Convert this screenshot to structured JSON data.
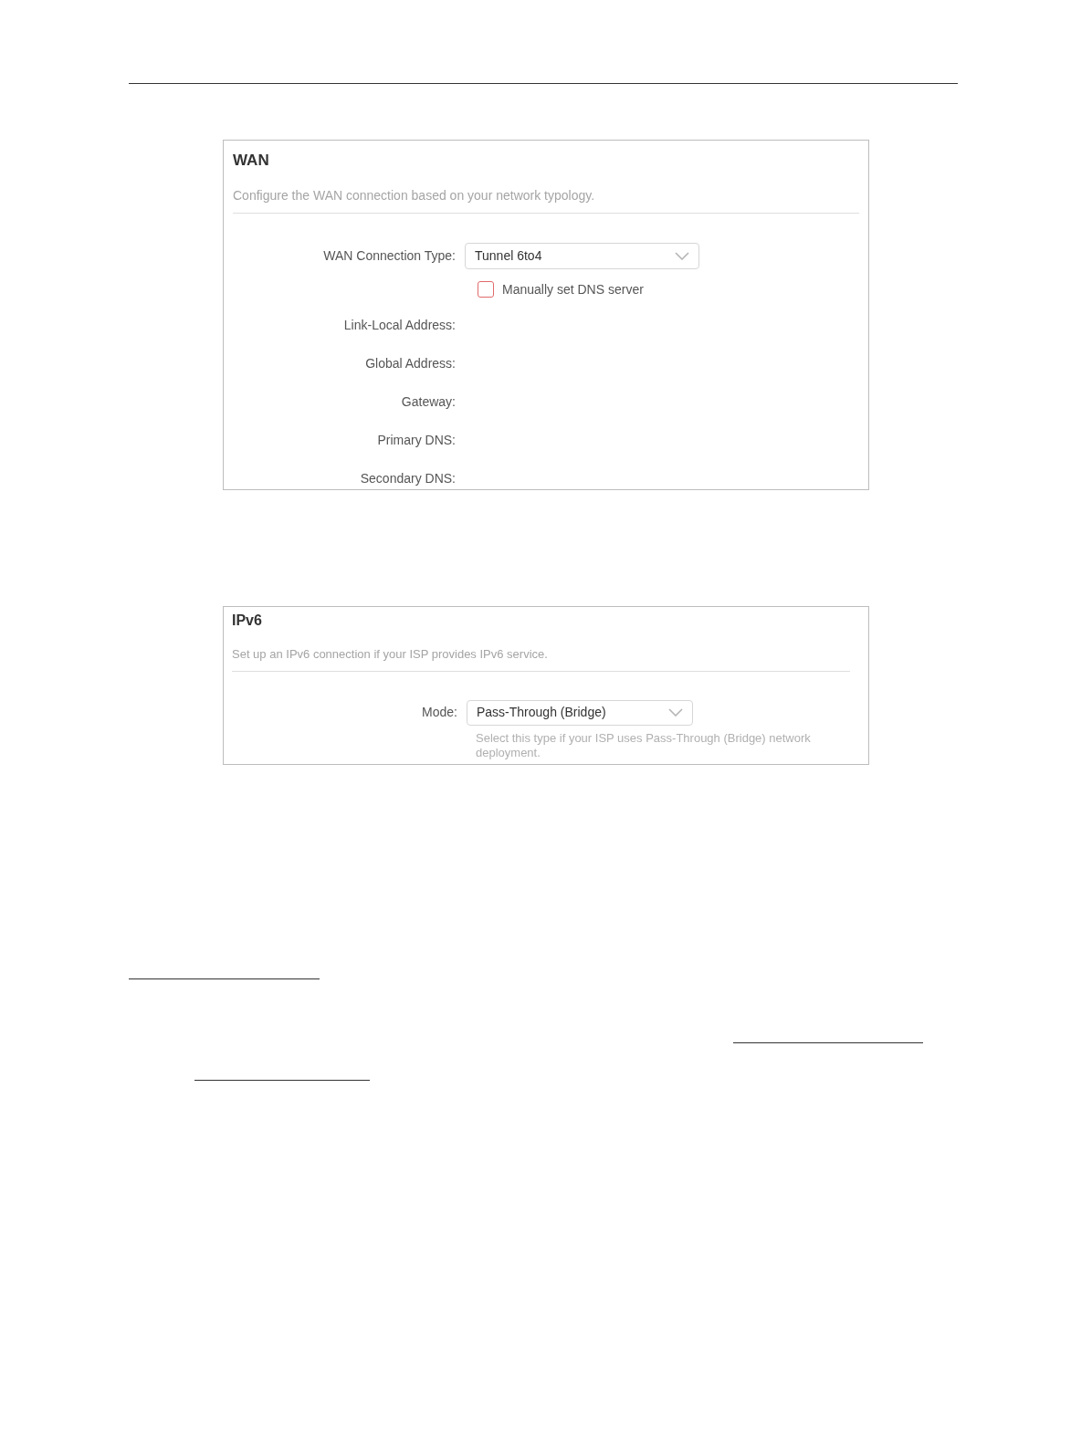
{
  "wan": {
    "title": "WAN",
    "description": "Configure the WAN connection based on your network typology.",
    "connection_type": {
      "label": "WAN Connection Type:",
      "value": "Tunnel 6to4"
    },
    "manual_dns": {
      "label": "Manually set DNS server",
      "checked": false
    },
    "fields": [
      {
        "label": "Link-Local Address:"
      },
      {
        "label": "Global Address:"
      },
      {
        "label": "Gateway:"
      },
      {
        "label": "Primary DNS:"
      },
      {
        "label": "Secondary DNS:"
      }
    ]
  },
  "ipv6": {
    "title": "IPv6",
    "description": "Set up an IPv6 connection if your ISP provides IPv6 service.",
    "mode": {
      "label": "Mode:",
      "value": "Pass-Through (Bridge)"
    },
    "hint": "Select this type if your ISP uses Pass-Through (Bridge) network deployment."
  }
}
